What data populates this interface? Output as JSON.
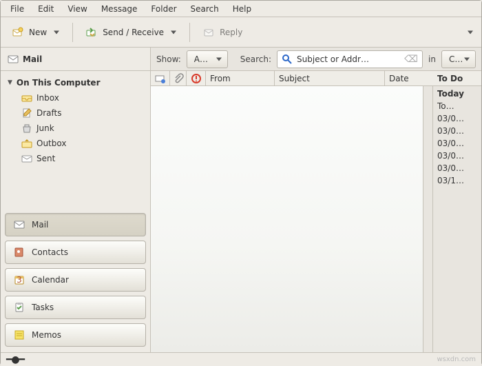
{
  "menu": [
    "File",
    "Edit",
    "View",
    "Message",
    "Folder",
    "Search",
    "Help"
  ],
  "toolbar": {
    "new": "New",
    "sendreceive": "Send / Receive",
    "reply": "Reply"
  },
  "filter": {
    "section_label": "Mail",
    "show_label": "Show:",
    "show_value": "A…",
    "search_label": "Search:",
    "search_placeholder": "Subject or Addr…",
    "in_label": "in",
    "in_value": "C…"
  },
  "tree": {
    "root": "On This Computer",
    "folders": [
      "Inbox",
      "Drafts",
      "Junk",
      "Outbox",
      "Sent"
    ]
  },
  "switcher": {
    "mail": "Mail",
    "contacts": "Contacts",
    "calendar": "Calendar",
    "tasks": "Tasks",
    "memos": "Memos"
  },
  "columns": {
    "from": "From",
    "subject": "Subject",
    "date": "Date"
  },
  "todo": {
    "header": "To Do",
    "items": [
      "Today",
      "To…",
      "03/0…",
      "03/0…",
      "03/0…",
      "03/0…",
      "03/0…",
      "03/1…"
    ]
  },
  "watermark": "wsxdn.com",
  "icons": {
    "new": "new-mail-icon",
    "sendreceive": "send-receive-icon",
    "reply": "reply-icon",
    "envelope": "envelope-icon",
    "search": "search-icon",
    "important": "important-icon",
    "attachment": "attachment-icon"
  }
}
